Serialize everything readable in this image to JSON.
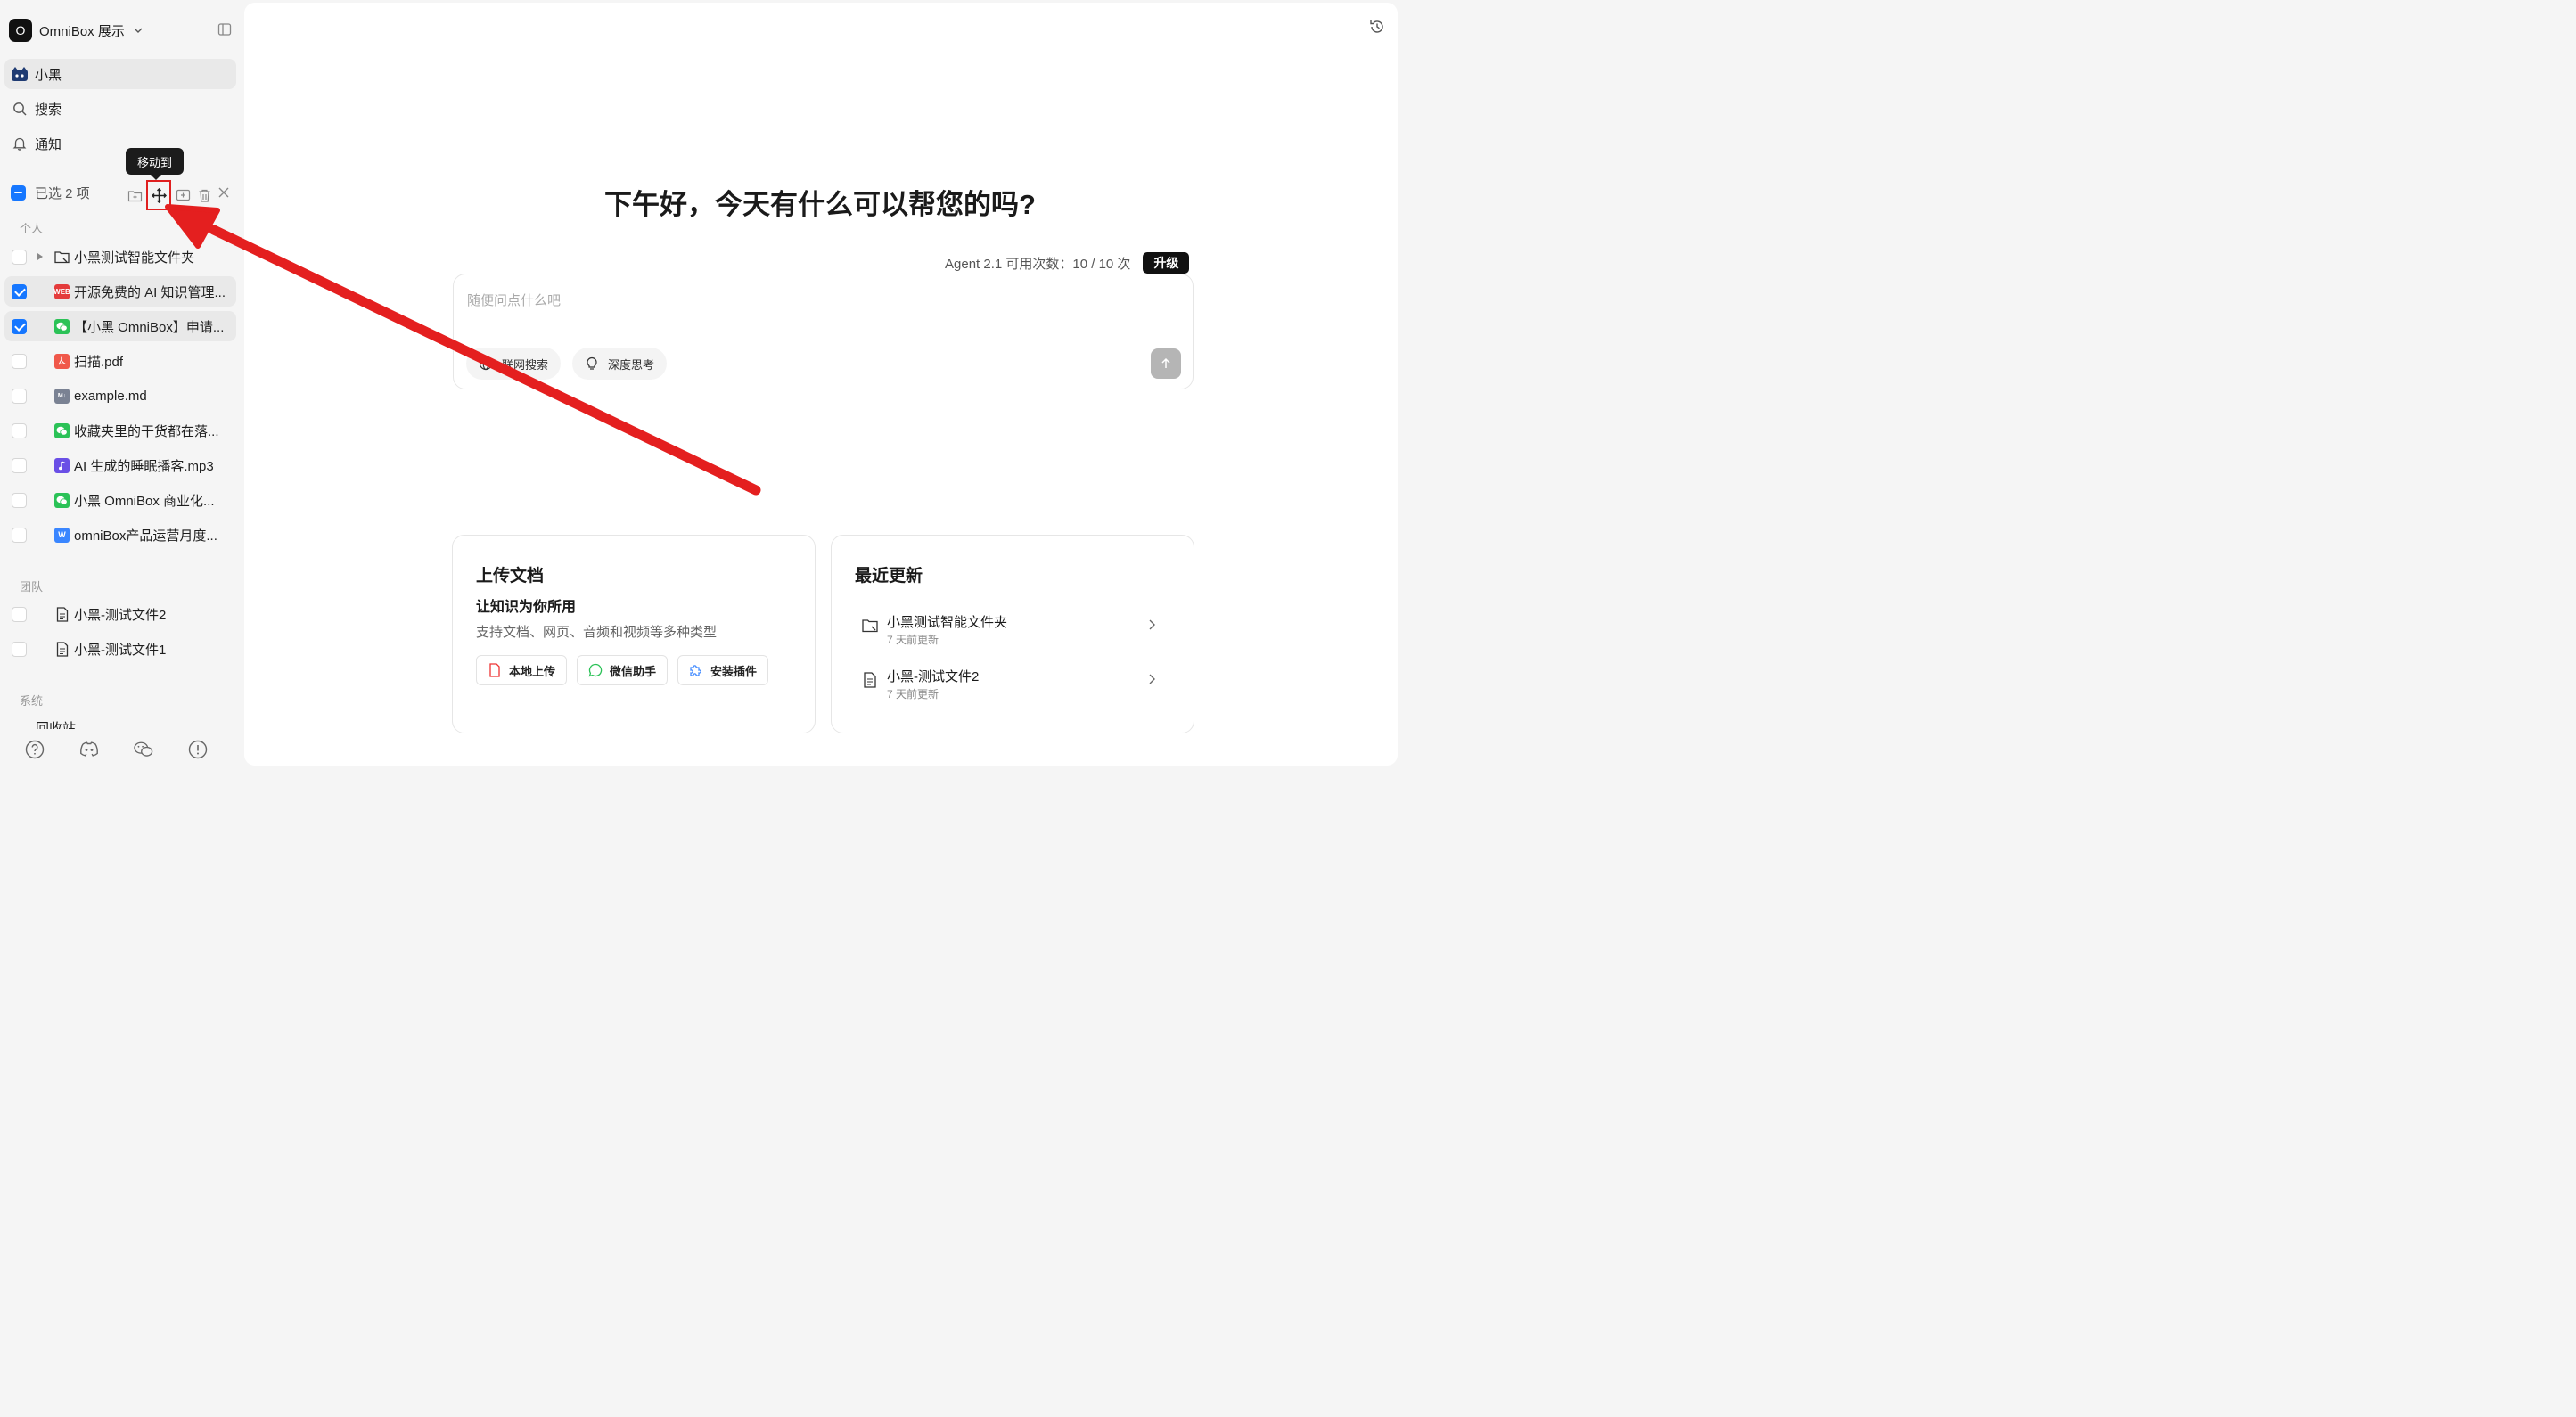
{
  "workspace": {
    "avatar_letter": "O",
    "name": "OmniBox 展示"
  },
  "nav": {
    "home": "小黑",
    "search": "搜索",
    "notifications": "通知"
  },
  "selection": {
    "label": "已选 2 项",
    "tooltip": "移动到"
  },
  "sections": {
    "personal": "个人",
    "team": "团队",
    "system": "系统",
    "trash_partial": "回收站"
  },
  "personal_items": [
    {
      "name": "小黑测试智能文件夹",
      "checked": false,
      "type": "folder"
    },
    {
      "name": "开源免费的 AI 知识管理...",
      "checked": true,
      "type": "web"
    },
    {
      "name": "【小黑 OmniBox】申请...",
      "checked": true,
      "type": "wechat"
    },
    {
      "name": "扫描.pdf",
      "checked": false,
      "type": "pdf"
    },
    {
      "name": "example.md",
      "checked": false,
      "type": "md"
    },
    {
      "name": "收藏夹里的干货都在落...",
      "checked": false,
      "type": "wechat"
    },
    {
      "name": "AI 生成的睡眠播客.mp3",
      "checked": false,
      "type": "audio"
    },
    {
      "name": "小黑 OmniBox 商业化...",
      "checked": false,
      "type": "wechat"
    },
    {
      "name": "omniBox产品运营月度...",
      "checked": false,
      "type": "doc"
    }
  ],
  "team_items": [
    {
      "name": "小黑-测试文件2",
      "checked": false
    },
    {
      "name": "小黑-测试文件1",
      "checked": false
    }
  ],
  "main": {
    "greeting": "下午好，今天有什么可以帮您的吗?",
    "quota_text": "Agent 2.1 可用次数：10 / 10 次",
    "upgrade": "升级",
    "input_placeholder": "随便问点什么吧",
    "web_search": "联网搜索",
    "deep_think": "深度思考"
  },
  "upload_card": {
    "title": "上传文档",
    "subtitle": "让知识为你所用",
    "desc": "支持文档、网页、音频和视频等多种类型",
    "local": "本地上传",
    "wechat": "微信助手",
    "plugin": "安装插件"
  },
  "recent_card": {
    "title": "最近更新",
    "items": [
      {
        "name": "小黑测试智能文件夹",
        "time": "7 天前更新"
      },
      {
        "name": "小黑-测试文件2",
        "time": "7 天前更新"
      }
    ]
  },
  "colors": {
    "accent": "#1677ff",
    "annotation": "#e02020"
  }
}
